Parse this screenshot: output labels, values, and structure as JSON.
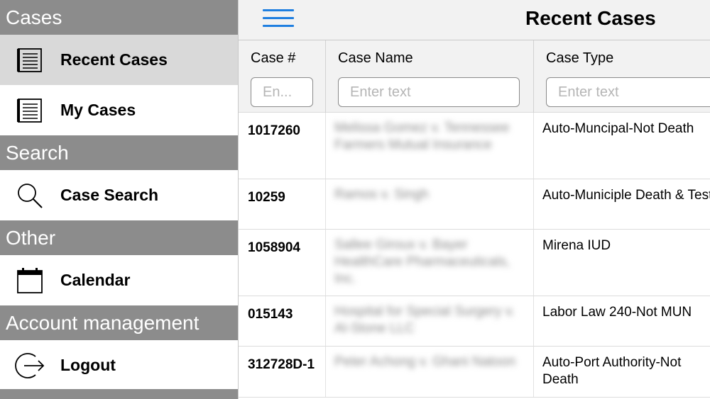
{
  "sidebar": {
    "sections": [
      {
        "header": "Cases",
        "items": [
          {
            "label": "Recent Cases",
            "icon": "list-document-icon",
            "selected": true
          },
          {
            "label": "My Cases",
            "icon": "list-document-icon",
            "selected": false
          }
        ]
      },
      {
        "header": "Search",
        "items": [
          {
            "label": "Case Search",
            "icon": "search-icon",
            "selected": false
          }
        ]
      },
      {
        "header": "Other",
        "items": [
          {
            "label": "Calendar",
            "icon": "calendar-icon",
            "selected": false
          }
        ]
      },
      {
        "header": "Account management",
        "items": [
          {
            "label": "Logout",
            "icon": "logout-icon",
            "selected": false
          }
        ]
      }
    ]
  },
  "topbar": {
    "title": "Recent Cases",
    "menu_icon": "hamburger-menu-icon",
    "accent_color": "#1f7fe0"
  },
  "table": {
    "columns": [
      {
        "label": "Case #",
        "placeholder": "En..."
      },
      {
        "label": "Case Name",
        "placeholder": "Enter text"
      },
      {
        "label": "Case Type",
        "placeholder": "Enter text"
      }
    ],
    "rows": [
      {
        "case_no": "1017260",
        "case_name": "Melissa Gomez v. Tennessee Farmers Mutual Insurance",
        "case_type": "Auto-Muncipal-Not Death"
      },
      {
        "case_no": "10259",
        "case_name": "Ramos v. Singh",
        "case_type": "Auto-Municiple Death & Test"
      },
      {
        "case_no": "1058904",
        "case_name": "Sallee Giroux v. Bayer HealthCare Pharmaceuticals, Inc.",
        "case_type": "Mirena IUD"
      },
      {
        "case_no": "015143",
        "case_name": "Hospital for Special Surgery v. Al-Stone LLC",
        "case_type": "Labor Law 240-Not MUN"
      },
      {
        "case_no": "312728D-1",
        "case_name": "Peter Achong v. Ghani Natoon",
        "case_type": "Auto-Port Authority-Not Death"
      }
    ]
  }
}
